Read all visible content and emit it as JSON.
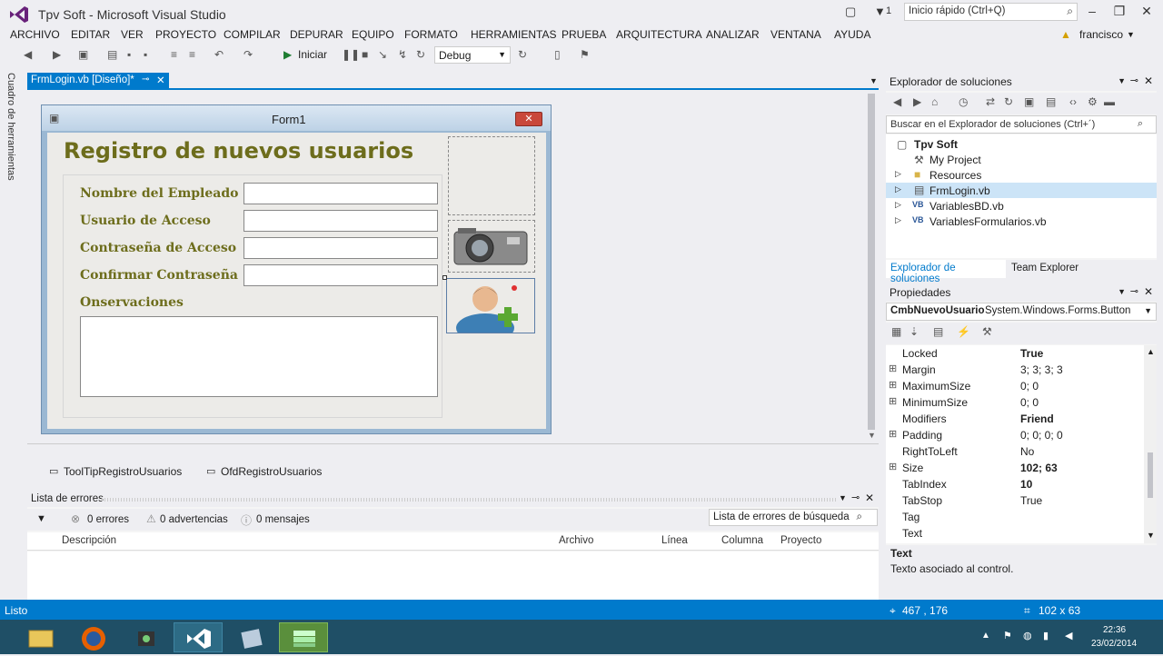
{
  "window": {
    "title": "Tpv Soft - Microsoft Visual Studio",
    "quick_launch_placeholder": "Inicio rápido (Ctrl+Q)",
    "notif_count": "1"
  },
  "menu": [
    "ARCHIVO",
    "EDITAR",
    "VER",
    "PROYECTO",
    "COMPILAR",
    "DEPURAR",
    "EQUIPO",
    "FORMATO",
    "HERRAMIENTAS",
    "PRUEBA",
    "ARQUITECTURA",
    "ANALIZAR",
    "VENTANA",
    "AYUDA"
  ],
  "user": {
    "name": "francisco"
  },
  "toolbar": {
    "start_label": "Iniciar",
    "config": "Debug"
  },
  "left_strip": {
    "toolbox_label": "Cuadro de herramientas"
  },
  "document": {
    "tab_label": "FrmLogin.vb [Diseño]*"
  },
  "form": {
    "title": "Form1",
    "heading": "Registro de nuevos usuarios",
    "labels": {
      "employee": "Nombre del Empleado",
      "user": "Usuario de Acceso",
      "password": "Contraseña de Acceso",
      "confirm": "Confirmar Contraseña",
      "notes": "Onservaciones"
    }
  },
  "components": {
    "tooltip": "ToolTipRegistroUsuarios",
    "dialog": "OfdRegistroUsuarios"
  },
  "errors": {
    "title": "Lista de errores",
    "errors_count": "0 errores",
    "warnings_count": "0 advertencias",
    "messages_count": "0 mensajes",
    "search_placeholder": "Lista de errores de búsqueda",
    "columns": [
      "Descripción",
      "Archivo",
      "Línea",
      "Columna",
      "Proyecto"
    ]
  },
  "solution_explorer": {
    "title": "Explorador de soluciones",
    "search_placeholder": "Buscar en el Explorador de soluciones (Ctrl+´)",
    "items": [
      {
        "label": "Tpv Soft"
      },
      {
        "label": "My Project"
      },
      {
        "label": "Resources"
      },
      {
        "label": "FrmLogin.vb"
      },
      {
        "label": "VariablesBD.vb"
      },
      {
        "label": "VariablesFormularios.vb"
      }
    ],
    "tabs": [
      "Explorador de soluciones",
      "Team Explorer"
    ]
  },
  "properties": {
    "title": "Propiedades",
    "object_name": "CmbNuevoUsuario",
    "object_type": "System.Windows.Forms.Button",
    "rows": [
      {
        "name": "Locked",
        "value": "True"
      },
      {
        "name": "Margin",
        "value": "3; 3; 3; 3"
      },
      {
        "name": "MaximumSize",
        "value": "0; 0"
      },
      {
        "name": "MinimumSize",
        "value": "0; 0"
      },
      {
        "name": "Modifiers",
        "value": "Friend"
      },
      {
        "name": "Padding",
        "value": "0; 0; 0; 0"
      },
      {
        "name": "RightToLeft",
        "value": "No"
      },
      {
        "name": "Size",
        "value": "102; 63"
      },
      {
        "name": "TabIndex",
        "value": "10"
      },
      {
        "name": "TabStop",
        "value": "True"
      },
      {
        "name": "Tag",
        "value": ""
      },
      {
        "name": "Text",
        "value": ""
      }
    ],
    "desc_title": "Text",
    "desc_text": "Texto asociado al control."
  },
  "statusbar": {
    "state": "Listo",
    "position": "467 , 176",
    "size": "102 x 63"
  },
  "taskbar": {
    "time": "22:36",
    "date": "23/02/2014"
  },
  "colors": {
    "accent": "#007acc",
    "label_olive": "#6d6d1c"
  }
}
